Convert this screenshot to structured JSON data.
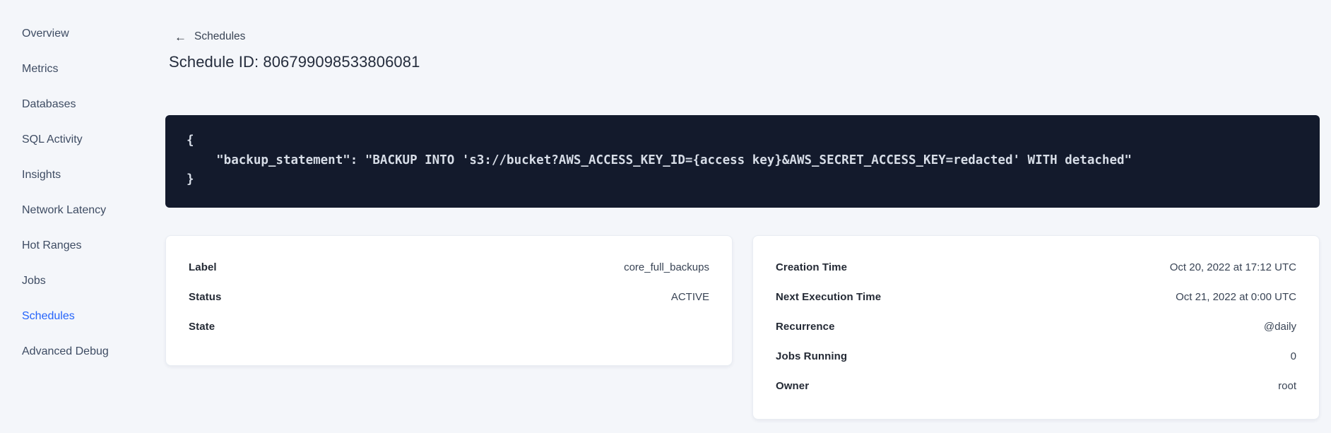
{
  "sidebar": {
    "items": [
      {
        "label": "Overview",
        "active": false
      },
      {
        "label": "Metrics",
        "active": false
      },
      {
        "label": "Databases",
        "active": false
      },
      {
        "label": "SQL Activity",
        "active": false
      },
      {
        "label": "Insights",
        "active": false
      },
      {
        "label": "Network Latency",
        "active": false
      },
      {
        "label": "Hot Ranges",
        "active": false
      },
      {
        "label": "Jobs",
        "active": false
      },
      {
        "label": "Schedules",
        "active": true
      },
      {
        "label": "Advanced Debug",
        "active": false
      }
    ]
  },
  "header": {
    "back_icon": "←",
    "back_label": "Schedules",
    "title": "Schedule ID: 806799098533806081"
  },
  "code_block": {
    "lines": [
      "{",
      "    \"backup_statement\": \"BACKUP INTO 's3://bucket?AWS_ACCESS_KEY_ID={access key}&AWS_SECRET_ACCESS_KEY=redacted' WITH detached\"",
      "}"
    ]
  },
  "details_card": {
    "rows": [
      {
        "label": "Label",
        "value": "core_full_backups"
      },
      {
        "label": "Status",
        "value": "ACTIVE"
      },
      {
        "label": "State",
        "value": ""
      }
    ]
  },
  "schedule_card": {
    "rows": [
      {
        "label": "Creation Time",
        "value": "Oct 20, 2022 at 17:12 UTC"
      },
      {
        "label": "Next Execution Time",
        "value": "Oct 21, 2022 at 0:00 UTC"
      },
      {
        "label": "Recurrence",
        "value": "@daily"
      },
      {
        "label": "Jobs Running",
        "value": "0"
      },
      {
        "label": "Owner",
        "value": "root"
      }
    ]
  },
  "colors": {
    "page_bg": "#f4f6fa",
    "accent_blue": "#2463fb",
    "code_bg": "#131a2c",
    "code_text": "#d7dde7"
  }
}
